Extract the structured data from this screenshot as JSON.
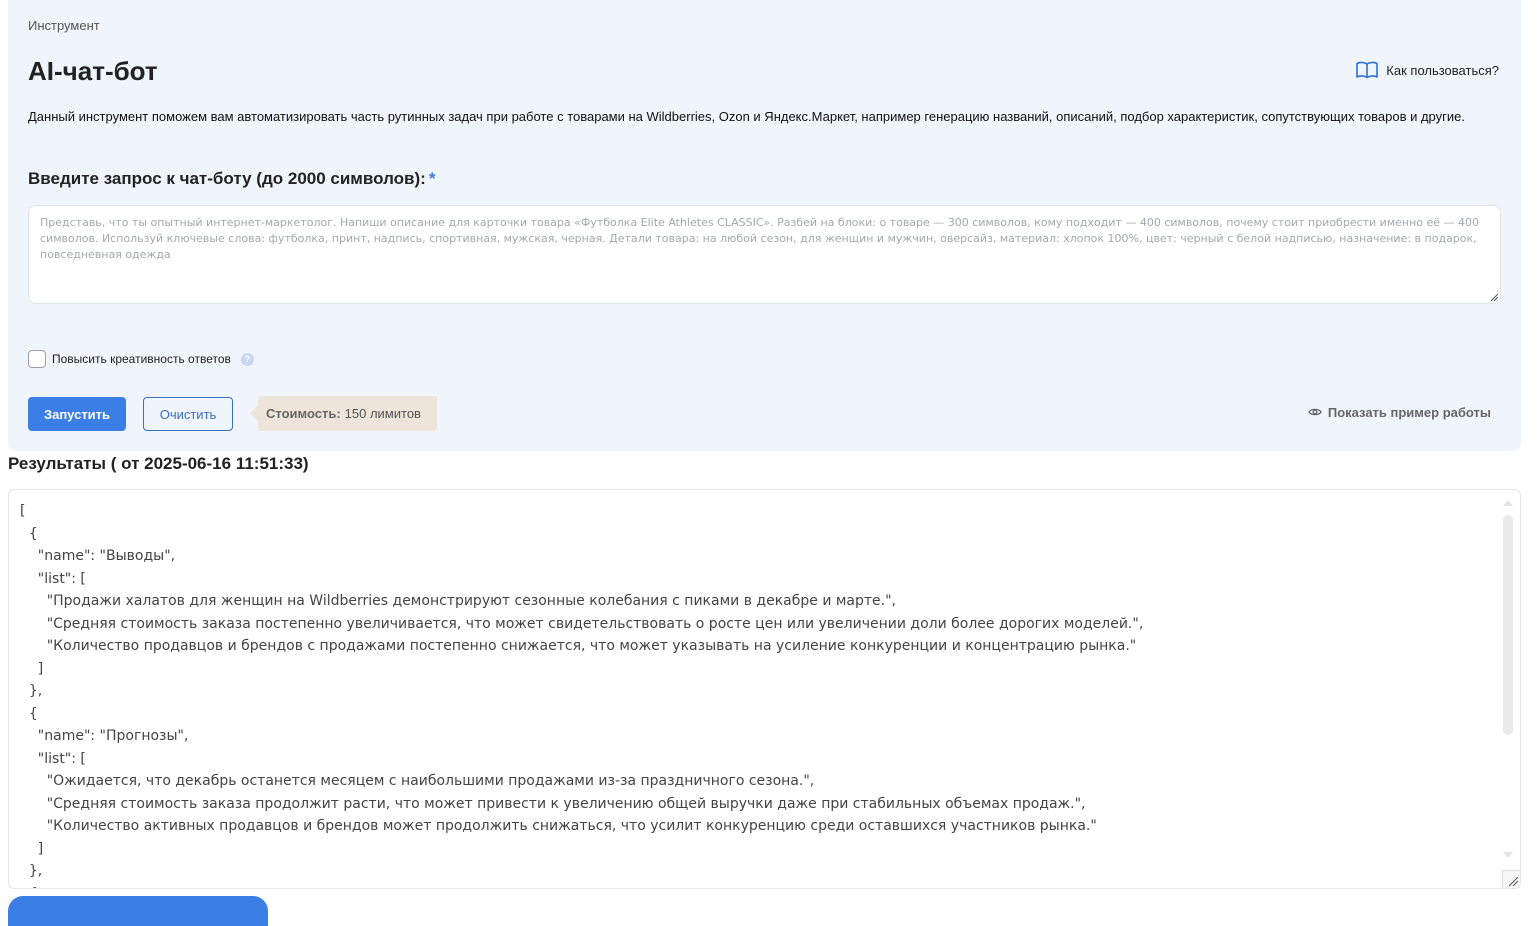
{
  "breadcrumb": "Инструмент",
  "page_title": "AI-чат-бот",
  "how_to_use": "Как пользоваться?",
  "description": "Данный инструмент поможем вам автоматизировать часть рутинных задач при работе с товарами на Wildberries, Ozon и Яндекс.Маркет, например генерацию названий, описаний, подбор характеристик, сопутствующих товаров и другие.",
  "prompt": {
    "label": "Введите запрос к чат-боту (до 2000 символов):",
    "required_mark": "*",
    "value": "",
    "placeholder": "Представь, что ты опытный интернет-маркетолог. Напиши описание для карточки товара «Футболка Elite Athletes CLASSIC». Разбей на блоки: о товаре — 300 символов, кому подходит — 400 символов, почему стоит приобрести именно её — 400 символов. Используй ключевые слова: футболка, принт, надпись, спортивная, мужская, черная. Детали товара: на любой сезон, для женщин и мужчин, оверсайз, материал: хлопок 100%, цвет: черный с белой надписью, назначение: в подарок, повседневная одежда"
  },
  "creativity": {
    "label": "Повысить креативность ответов",
    "checked": false,
    "help_icon": "?"
  },
  "actions": {
    "run_label": "Запустить",
    "clear_label": "Очистить",
    "cost_label": "Стоимость:",
    "cost_value": "150 лимитов",
    "show_example_label": "Показать пример работы"
  },
  "results": {
    "title": "Результаты ( от 2025-06-16 11:51:33)",
    "text": "[\n  {\n    \"name\": \"Выводы\",\n    \"list\": [\n      \"Продажи халатов для женщин на Wildberries демонстрируют сезонные колебания с пиками в декабре и марте.\",\n      \"Средняя стоимость заказа постепенно увеличивается, что может свидетельствовать о росте цен или увеличении доли более дорогих моделей.\",\n      \"Количество продавцов и брендов с продажами постепенно снижается, что может указывать на усиление конкуренции и концентрацию рынка.\"\n    ]\n  },\n  {\n    \"name\": \"Прогнозы\",\n    \"list\": [\n      \"Ожидается, что декабрь останется месяцем с наибольшими продажами из-за праздничного сезона.\",\n      \"Средняя стоимость заказа продолжит расти, что может привести к увеличению общей выручки даже при стабильных объемах продаж.\",\n      \"Количество активных продавцов и брендов может продолжить снижаться, что усилит конкуренцию среди оставшихся участников рынка.\"\n    ]\n  },\n  {"
  },
  "colors": {
    "panel_background": "#f0f4fb",
    "primary": "#3a7ee6",
    "cost_badge": "#ede5da"
  },
  "icons": {
    "how_to_use": "book-icon",
    "show_example": "eye-icon",
    "help": "help-icon"
  }
}
